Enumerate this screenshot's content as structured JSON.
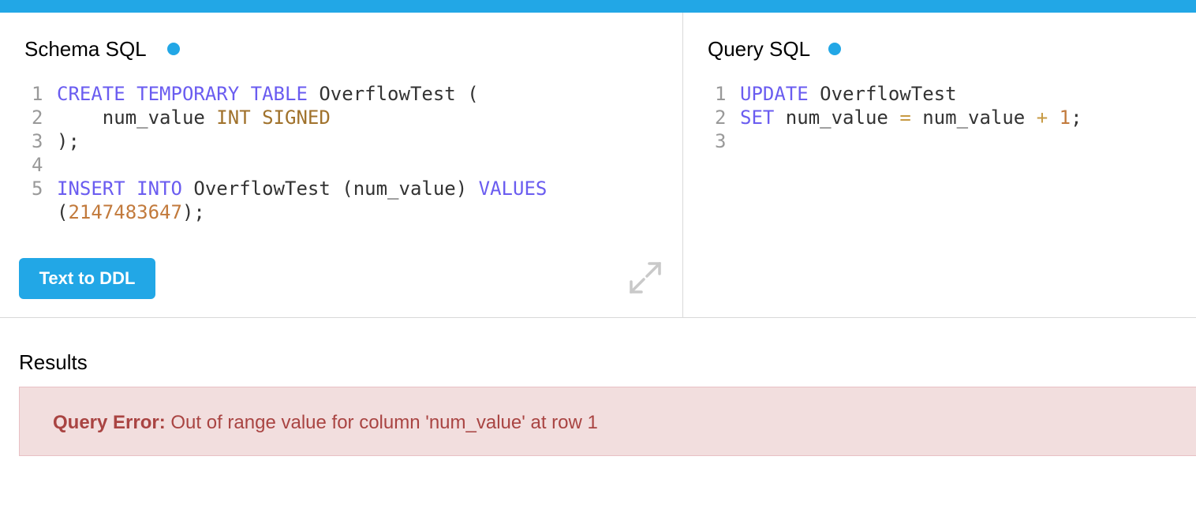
{
  "colors": {
    "accent": "#22a7e6",
    "keyword": "#6a5cf0",
    "type": "#a0722c",
    "number": "#c27a3c",
    "error_bg": "#f2dede",
    "error_text": "#a94442"
  },
  "schema": {
    "title": "Schema SQL",
    "lines": [
      {
        "num": "1",
        "tokens": [
          "CREATE",
          " ",
          "TEMPORARY",
          " ",
          "TABLE",
          " OverflowTest ("
        ]
      },
      {
        "num": "2",
        "tokens": [
          "    num_value ",
          "INT",
          " ",
          "SIGNED"
        ]
      },
      {
        "num": "3",
        "tokens": [
          ");"
        ]
      },
      {
        "num": "4",
        "tokens": []
      },
      {
        "num": "5",
        "tokens": [
          "INSERT",
          " ",
          "INTO",
          " OverflowTest (num_value) ",
          "VALUES"
        ]
      },
      {
        "num": "",
        "tokens": [
          "(",
          "2147483647",
          ");"
        ]
      }
    ],
    "button_label": "Text to DDL",
    "expand_icon": "expand-icon"
  },
  "query": {
    "title": "Query SQL",
    "lines": [
      {
        "num": "1",
        "tokens": [
          "UPDATE",
          " OverflowTest"
        ]
      },
      {
        "num": "2",
        "tokens": [
          "SET",
          " num_value ",
          "=",
          " num_value ",
          "+",
          " ",
          "1",
          ";"
        ]
      },
      {
        "num": "3",
        "tokens": []
      }
    ]
  },
  "results": {
    "title": "Results",
    "error_label": "Query Error:",
    "error_message": "Out of range value for column 'num_value' at row 1"
  }
}
